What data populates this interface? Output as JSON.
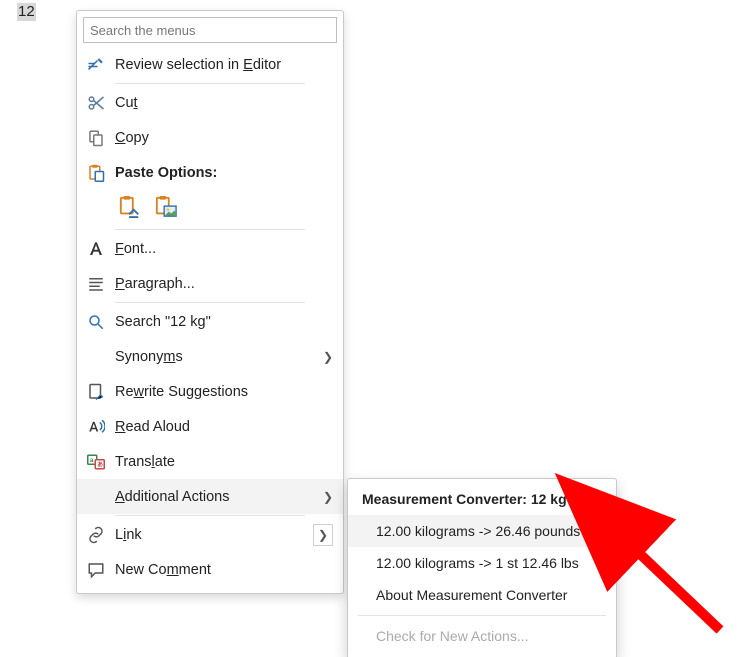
{
  "document": {
    "selection": "12"
  },
  "menu": {
    "search_placeholder": "Search the menus",
    "review_editor": "Review selection in Editor",
    "cut": "Cut",
    "copy": "Copy",
    "paste_options": "Paste Options:",
    "font": "Font...",
    "paragraph": "Paragraph...",
    "search_label": "Search \"12 kg\"",
    "synonyms": "Synonyms",
    "rewrite": "Rewrite Suggestions",
    "read_aloud": "Read Aloud",
    "translate": "Translate",
    "additional_actions": "Additional Actions",
    "link": "Link",
    "new_comment": "New Comment"
  },
  "submenu": {
    "header": "Measurement Converter: 12 kg",
    "items": [
      "12.00 kilograms -> 26.46 pounds",
      "12.00 kilograms -> 1 st 12.46 lbs",
      "About Measurement Converter"
    ],
    "check_new": "Check for New Actions..."
  }
}
